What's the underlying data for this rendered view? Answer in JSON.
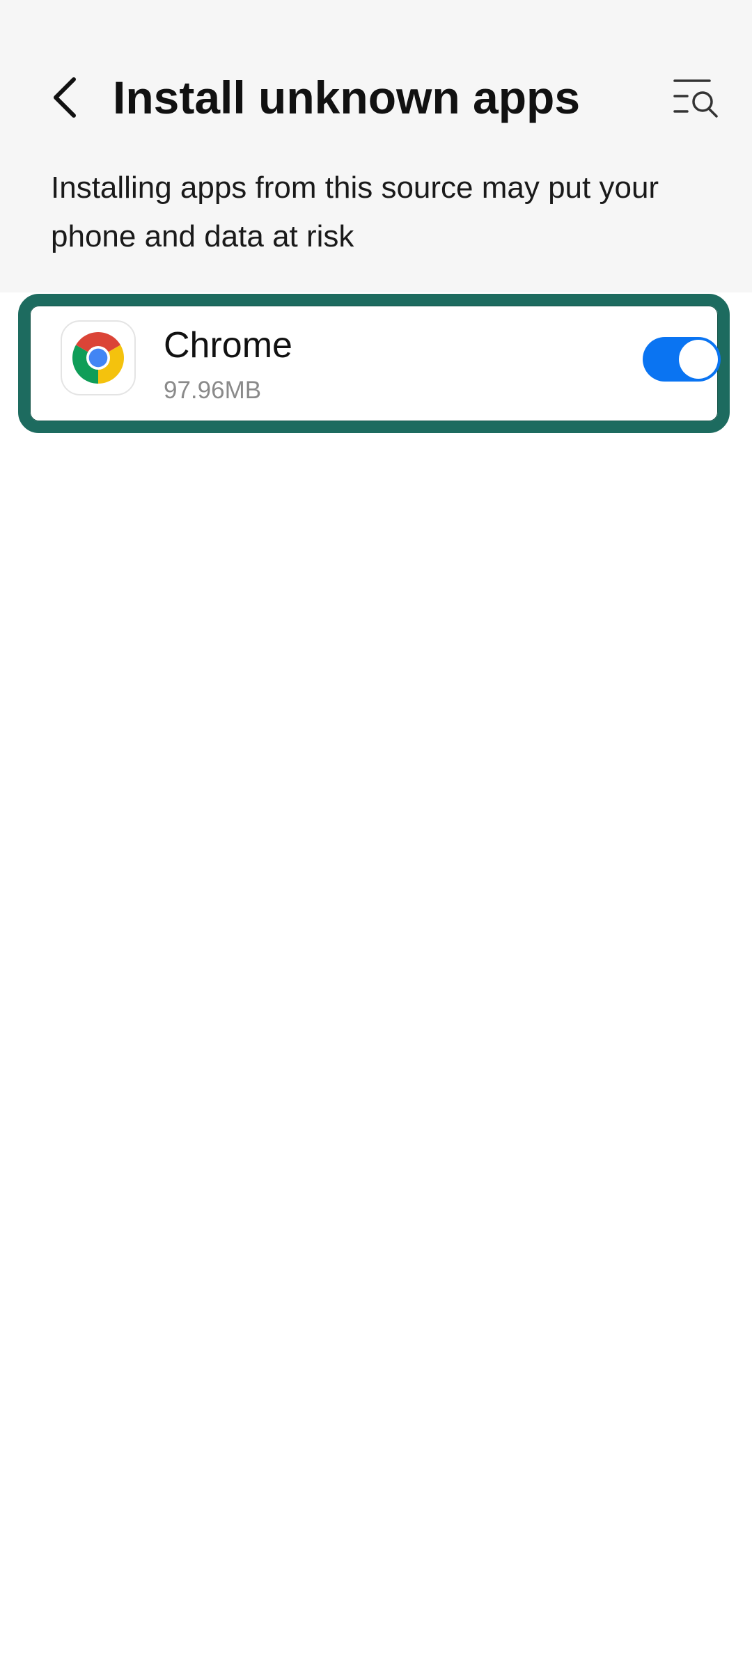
{
  "header": {
    "title": "Install unknown apps",
    "back_icon": "back-arrow-icon",
    "search_icon": "search-list-icon"
  },
  "warning": {
    "text": "Installing apps from this source may put your phone and data at risk"
  },
  "apps": [
    {
      "name": "Chrome",
      "size": "97.96MB",
      "icon": "chrome-icon",
      "allowed": true
    }
  ],
  "colors": {
    "toggle_on": "#0a74f2",
    "highlight_border": "#1d6b5f",
    "background_top": "#f6f6f6"
  }
}
